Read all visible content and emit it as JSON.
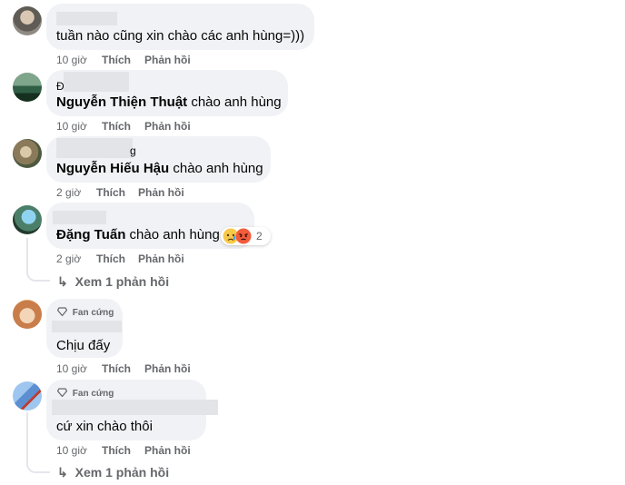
{
  "comments": [
    {
      "text": "tuần nào cũng xin chào các anh hùng=)))",
      "time": "10 giờ",
      "like": "Thích",
      "reply": "Phản hồi"
    },
    {
      "mention": "Nguyễn Thiện Thuật",
      "text": " chào anh hùng",
      "name_fragment": "Đ",
      "time": "10 giờ",
      "like": "Thích",
      "reply": "Phản hồi"
    },
    {
      "mention": "Nguyễn Hiếu Hậu",
      "text": " chào anh hùng",
      "name_fragment": "g",
      "time": "2 giờ",
      "like": "Thích",
      "reply": "Phản hồi"
    },
    {
      "mention": "Đặng Tuấn",
      "text": " chào anh hùng",
      "reaction_count": "2",
      "time": "2 giờ",
      "like": "Thích",
      "reply": "Phản hồi",
      "view_replies": "Xem 1 phản hồi"
    },
    {
      "badge": "Fan cứng",
      "text": "Chịu đấy",
      "time": "10 giờ",
      "like": "Thích",
      "reply": "Phản hồi"
    },
    {
      "badge": "Fan cứng",
      "text": "cứ xin chào thôi",
      "time": "10 giờ",
      "like": "Thích",
      "reply": "Phản hồi",
      "view_replies": "Xem 1 phản hồi"
    }
  ],
  "colors": {
    "bubble": "#f0f2f5",
    "meta": "#65676b",
    "text": "#050505"
  },
  "icons": {
    "reply_arrow": "↳",
    "badge": "diamond-icon",
    "reactions": [
      "sad-icon",
      "angry-icon"
    ]
  }
}
